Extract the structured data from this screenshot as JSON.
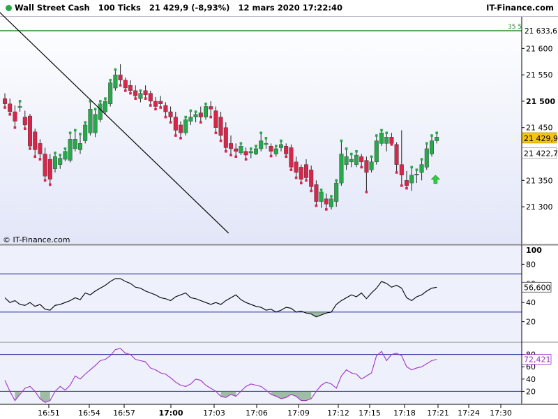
{
  "header": {
    "instrument": "Wall Street Cash",
    "interval": "100 Ticks",
    "quote": "21 429,9 (-8,93%)",
    "datetime": "12 mars 2020 17:22:40",
    "brand": "IT-Finance.com"
  },
  "watermark": "© IT-Finance.com",
  "colors": {
    "bull": "#27a84a",
    "bear": "#d8264a",
    "background": "#ffffff",
    "indicator_bg": "#eef1fb",
    "price_label": "#f3c414",
    "stoch_line": "#a030c8",
    "rsi_line": "#000000",
    "level_line": "#2c2ca0",
    "level_green": "#2e8b2e"
  },
  "chart_data": [
    {
      "type": "candlestick",
      "panel": "price",
      "ylim": [
        21230,
        21660
      ],
      "yticks": [
        21300,
        21350,
        21400,
        21450,
        21500,
        21550,
        21600
      ],
      "ytick_labels": [
        "21 300",
        "21 350",
        "21 400",
        "21 450",
        "21 500",
        "21 550",
        "21 600"
      ],
      "x_ticks": [
        "16:51",
        "16:54",
        "16:57",
        "17:00",
        "17:03",
        "17:06",
        "17:09",
        "17:12",
        "17:15",
        "17:18",
        "17:21",
        "17:24",
        "17:30"
      ],
      "bold_tick": "17:00",
      "current_price": "21 429,9",
      "secondary_price": "21 422,7",
      "level_price": "21 633,6",
      "level_value": 21633.6,
      "level_badge": "35 5",
      "trendline": [
        [
          -2.3,
          21680
        ],
        [
          39,
          21250
        ]
      ],
      "arrow_signal": {
        "index": 27,
        "price": 21352
      },
      "candles": [
        [
          21505,
          21515,
          21488,
          21495
        ],
        [
          21495,
          21505,
          21475,
          21480
        ],
        [
          21480,
          21492,
          21450,
          21462
        ],
        [
          21488,
          21500,
          21480,
          21490
        ],
        [
          21470,
          21482,
          21448,
          21455
        ],
        [
          21472,
          21476,
          21410,
          21415
        ],
        [
          21442,
          21448,
          21395,
          21408
        ],
        [
          21420,
          21428,
          21390,
          21400
        ],
        [
          21400,
          21412,
          21350,
          21358
        ],
        [
          21390,
          21400,
          21342,
          21352
        ],
        [
          21372,
          21402,
          21365,
          21395
        ],
        [
          21380,
          21398,
          21372,
          21392
        ],
        [
          21390,
          21410,
          21386,
          21405
        ],
        [
          21388,
          21440,
          21384,
          21428
        ],
        [
          21410,
          21445,
          21405,
          21428
        ],
        [
          21408,
          21438,
          21400,
          21420
        ],
        [
          21425,
          21460,
          21420,
          21455
        ],
        [
          21440,
          21500,
          21435,
          21485
        ],
        [
          21440,
          21485,
          21432,
          21475
        ],
        [
          21465,
          21500,
          21460,
          21495
        ],
        [
          21480,
          21505,
          21475,
          21500
        ],
        [
          21495,
          21540,
          21490,
          21535
        ],
        [
          21525,
          21560,
          21520,
          21550
        ],
        [
          21550,
          21570,
          21530,
          21540
        ],
        [
          21540,
          21545,
          21520,
          21525
        ],
        [
          21530,
          21540,
          21515,
          21520
        ],
        [
          21520,
          21530,
          21505,
          21510
        ],
        [
          21505,
          21520,
          21498,
          21515
        ],
        [
          21520,
          21530,
          21505,
          21512
        ],
        [
          21515,
          21520,
          21492,
          21500
        ],
        [
          21500,
          21508,
          21485,
          21490
        ],
        [
          21500,
          21510,
          21488,
          21495
        ],
        [
          21492,
          21498,
          21470,
          21480
        ],
        [
          21480,
          21490,
          21460,
          21470
        ],
        [
          21470,
          21480,
          21435,
          21445
        ],
        [
          21455,
          21462,
          21430,
          21440
        ],
        [
          21440,
          21470,
          21435,
          21465
        ],
        [
          21462,
          21482,
          21455,
          21470
        ],
        [
          21470,
          21480,
          21460,
          21475
        ],
        [
          21478,
          21490,
          21460,
          21470
        ],
        [
          21470,
          21495,
          21465,
          21490
        ],
        [
          21490,
          21500,
          21470,
          21485
        ],
        [
          21482,
          21490,
          21440,
          21450
        ],
        [
          21470,
          21480,
          21425,
          21435
        ],
        [
          21450,
          21460,
          21405,
          21412
        ],
        [
          21420,
          21435,
          21398,
          21410
        ],
        [
          21410,
          21420,
          21395,
          21405
        ],
        [
          21402,
          21420,
          21398,
          21415
        ],
        [
          21405,
          21412,
          21390,
          21398
        ],
        [
          21402,
          21410,
          21392,
          21405
        ],
        [
          21400,
          21415,
          21398,
          21410
        ],
        [
          21410,
          21440,
          21405,
          21425
        ],
        [
          21418,
          21430,
          21410,
          21420
        ],
        [
          21415,
          21420,
          21396,
          21405
        ],
        [
          21400,
          21415,
          21395,
          21410
        ],
        [
          21412,
          21425,
          21405,
          21418
        ],
        [
          21415,
          21420,
          21395,
          21400
        ],
        [
          21412,
          21418,
          21370,
          21375
        ],
        [
          21385,
          21395,
          21355,
          21365
        ],
        [
          21375,
          21380,
          21345,
          21352
        ],
        [
          21380,
          21390,
          21350,
          21355
        ],
        [
          21370,
          21378,
          21330,
          21338
        ],
        [
          21342,
          21350,
          21302,
          21310
        ],
        [
          21310,
          21332,
          21298,
          21328
        ],
        [
          21315,
          21325,
          21295,
          21305
        ],
        [
          21300,
          21320,
          21295,
          21315
        ],
        [
          21310,
          21350,
          21300,
          21345
        ],
        [
          21345,
          21425,
          21340,
          21400
        ],
        [
          21380,
          21410,
          21370,
          21395
        ],
        [
          21385,
          21400,
          21375,
          21390
        ],
        [
          21380,
          21405,
          21375,
          21398
        ],
        [
          21395,
          21400,
          21375,
          21385
        ],
        [
          21388,
          21395,
          21328,
          21365
        ],
        [
          21370,
          21395,
          21365,
          21385
        ],
        [
          21385,
          21435,
          21380,
          21425
        ],
        [
          21420,
          21445,
          21415,
          21440
        ],
        [
          21420,
          21440,
          21405,
          21432
        ],
        [
          21432,
          21440,
          21418,
          21420
        ],
        [
          21418,
          21422,
          21365,
          21380
        ],
        [
          21380,
          21445,
          21340,
          21360
        ],
        [
          21350,
          21368,
          21335,
          21340
        ],
        [
          21345,
          21375,
          21330,
          21360
        ],
        [
          21360,
          21370,
          21345,
          21362
        ],
        [
          21365,
          21390,
          21350,
          21380
        ],
        [
          21375,
          21420,
          21370,
          21410
        ],
        [
          21400,
          21435,
          21395,
          21425
        ],
        [
          21425,
          21440,
          21420,
          21432
        ]
      ]
    },
    {
      "type": "line",
      "panel": "rsi",
      "name": "",
      "ylim": [
        0,
        100
      ],
      "yticks": [
        20,
        40,
        60,
        80,
        100
      ],
      "levels": [
        30,
        70
      ],
      "last_value": "56,600",
      "values": [
        45,
        40,
        42,
        38,
        37,
        40,
        36,
        38,
        33,
        32,
        37,
        38,
        40,
        42,
        45,
        43,
        50,
        48,
        52,
        55,
        58,
        62,
        65,
        65,
        62,
        60,
        56,
        55,
        52,
        50,
        48,
        45,
        44,
        42,
        46,
        48,
        50,
        45,
        44,
        42,
        40,
        38,
        40,
        38,
        42,
        45,
        48,
        43,
        40,
        38,
        36,
        35,
        32,
        33,
        30,
        32,
        35,
        34,
        30,
        31,
        29,
        28,
        25,
        27,
        29,
        30,
        38,
        42,
        45,
        48,
        46,
        50,
        44,
        50,
        55,
        62,
        60,
        56,
        58,
        55,
        45,
        42,
        46,
        48,
        52,
        55,
        56
      ]
    },
    {
      "type": "line",
      "panel": "stochastic",
      "name": "",
      "ylim": [
        0,
        100
      ],
      "yticks": [
        20,
        40,
        60,
        80
      ],
      "levels": [
        20,
        80
      ],
      "last_value": "72,421",
      "values": [
        38,
        20,
        5,
        15,
        25,
        28,
        20,
        8,
        2,
        5,
        20,
        28,
        22,
        30,
        45,
        40,
        48,
        55,
        62,
        70,
        72,
        78,
        88,
        90,
        82,
        80,
        72,
        70,
        68,
        58,
        55,
        50,
        48,
        42,
        35,
        30,
        28,
        32,
        40,
        38,
        30,
        25,
        20,
        12,
        10,
        15,
        12,
        20,
        28,
        32,
        30,
        28,
        22,
        15,
        12,
        8,
        10,
        15,
        12,
        5,
        5,
        8,
        20,
        30,
        35,
        32,
        25,
        45,
        55,
        50,
        48,
        40,
        45,
        50,
        78,
        85,
        70,
        80,
        82,
        78,
        60,
        55,
        58,
        60,
        65,
        70,
        72
      ]
    }
  ]
}
